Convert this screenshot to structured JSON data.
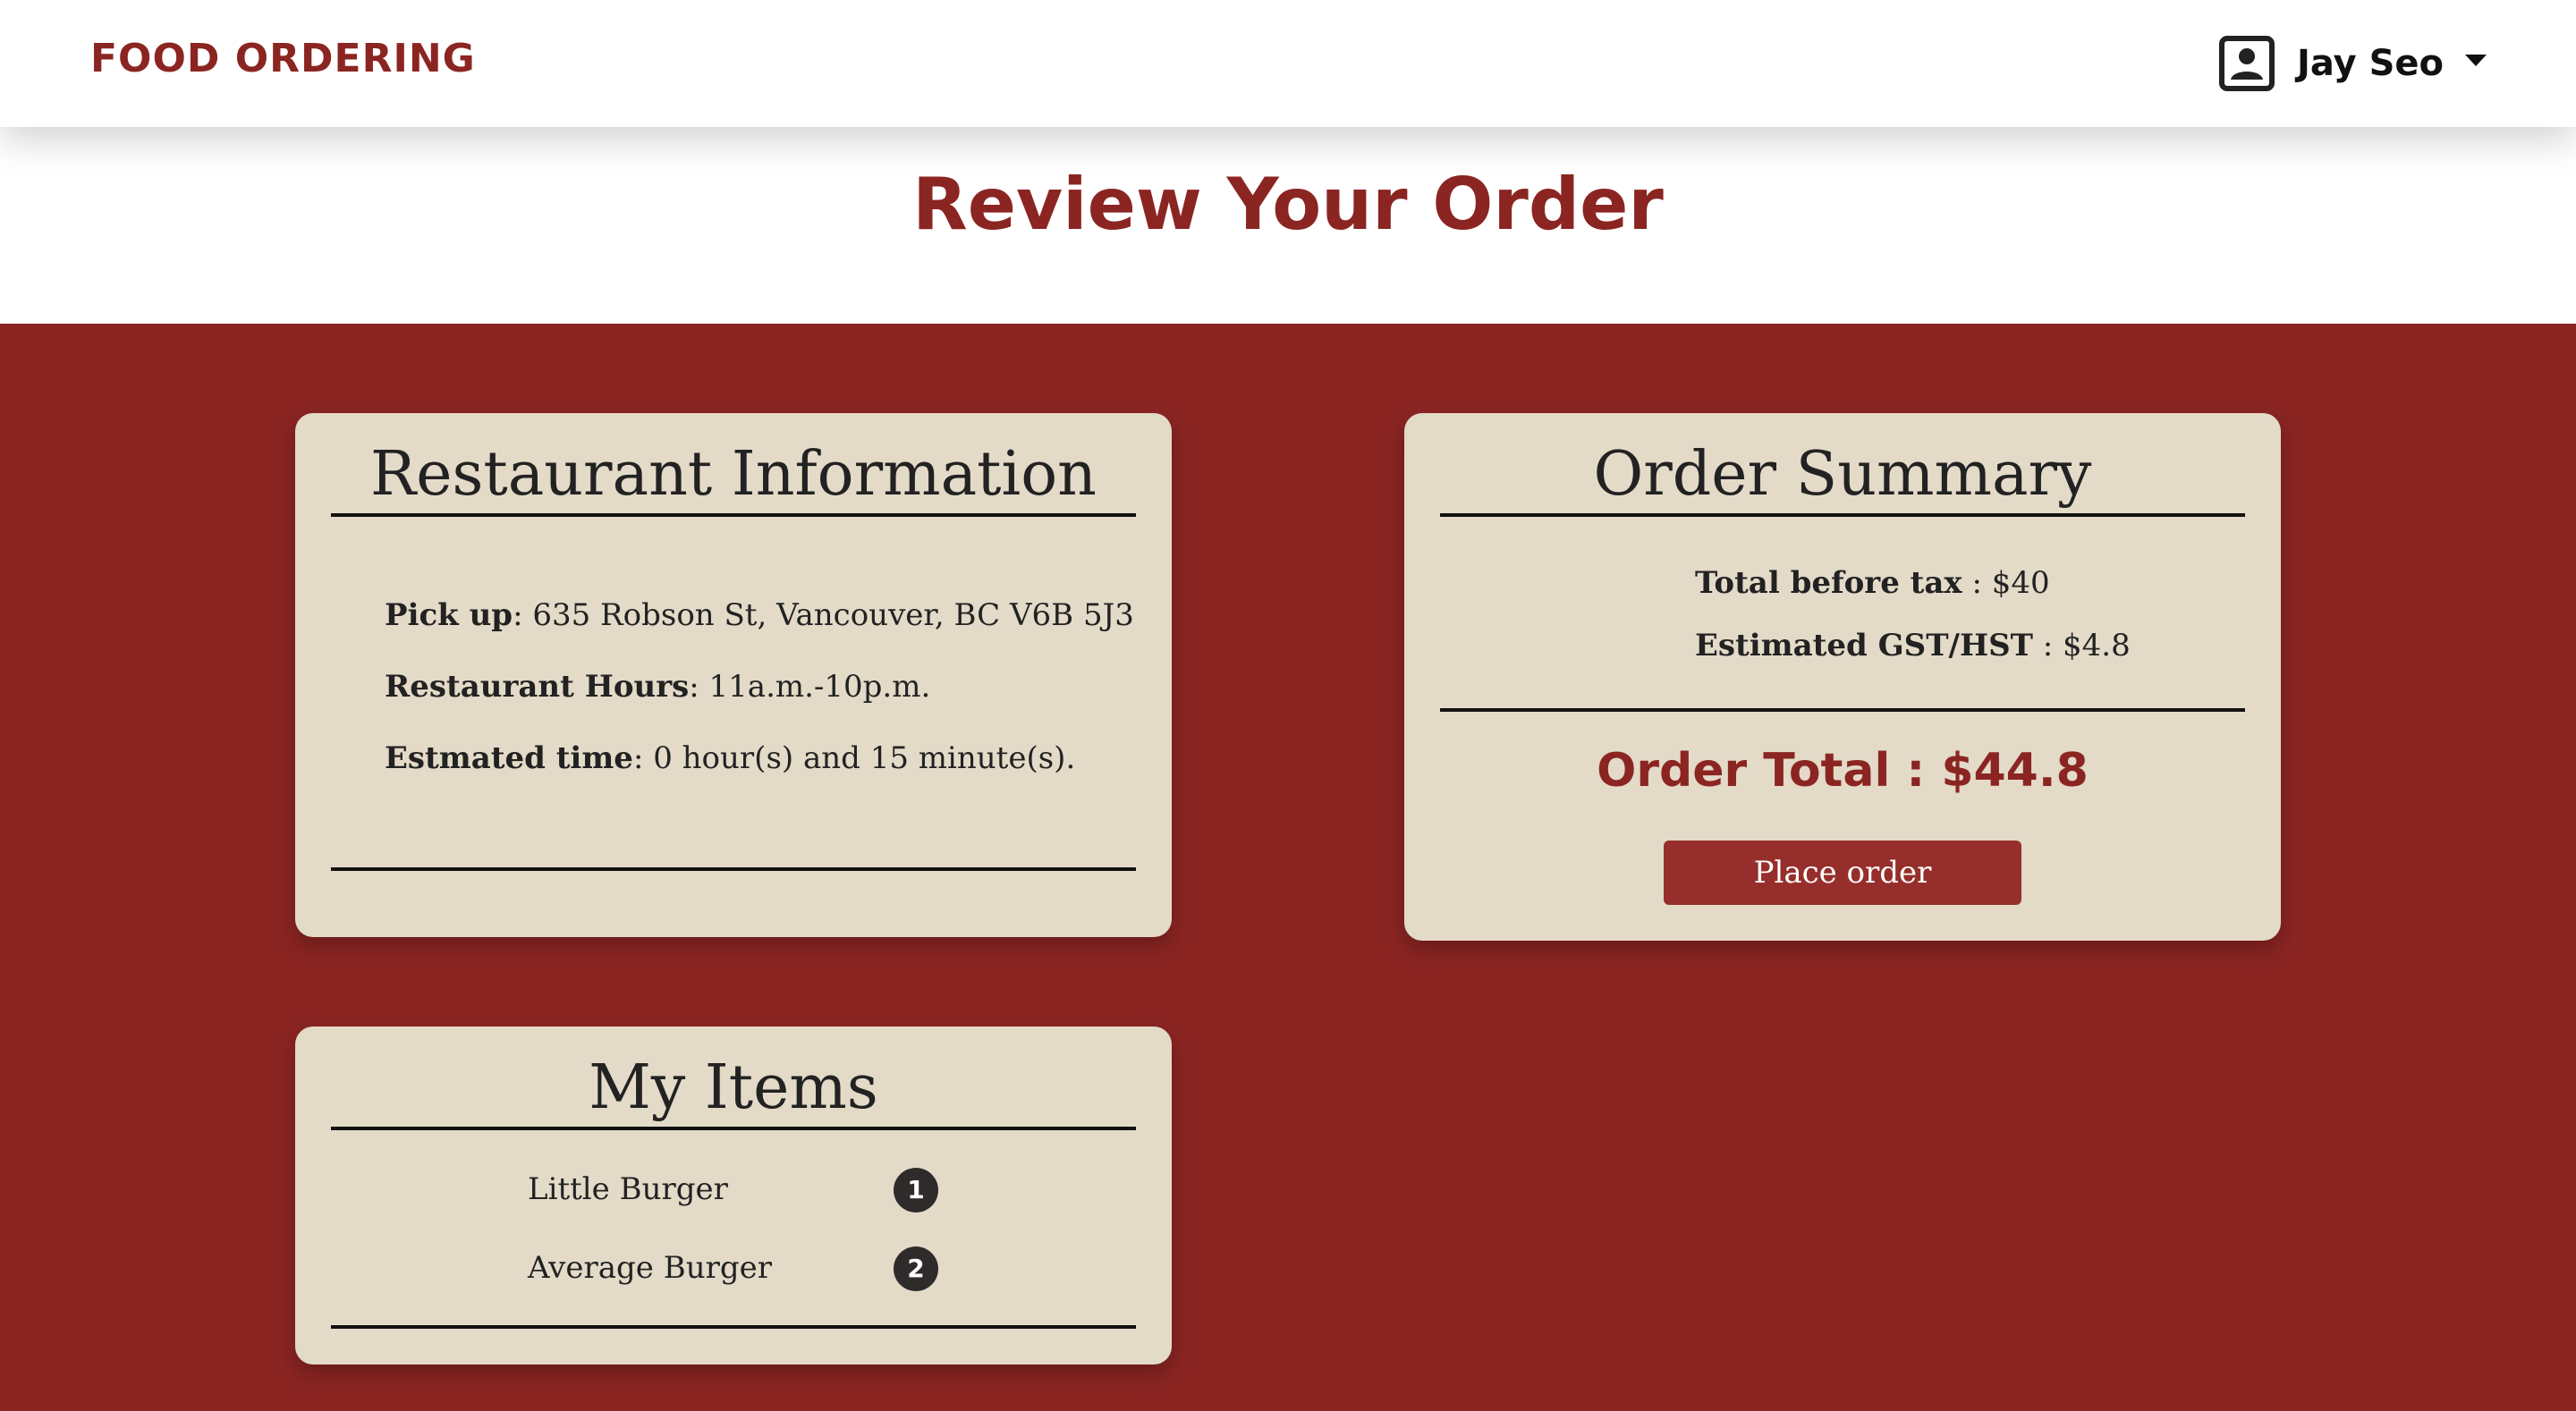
{
  "nav": {
    "brand": "FOOD ORDERING",
    "user_name": "Jay Seo",
    "user_icon": "account-box-icon"
  },
  "page": {
    "title": "Review Your Order"
  },
  "restaurant": {
    "title": "Restaurant Information",
    "pickup_label": "Pick up",
    "pickup_value": ": 635 Robson St, Vancouver, BC V6B 5J3",
    "hours_label": "Restaurant Hours",
    "hours_value": ": 11a.m.-10p.m.",
    "time_label": "Estmated time",
    "time_value": ": 0 hour(s) and 15 minute(s)."
  },
  "summary": {
    "title": "Order Summary",
    "before_tax_label": "Total before tax",
    "before_tax_value": " : $40",
    "gst_label": "Estimated GST/HST",
    "gst_value": " : $4.8",
    "order_total": "Order Total : $44.8",
    "place_order_label": "Place order"
  },
  "items": {
    "title": "My Items",
    "list": [
      {
        "name": "Little Burger",
        "qty": "1"
      },
      {
        "name": "Average Burger",
        "qty": "2"
      }
    ]
  },
  "colors": {
    "brand": "#8b2522",
    "card": "#e3dac8",
    "button": "#962f2b"
  }
}
